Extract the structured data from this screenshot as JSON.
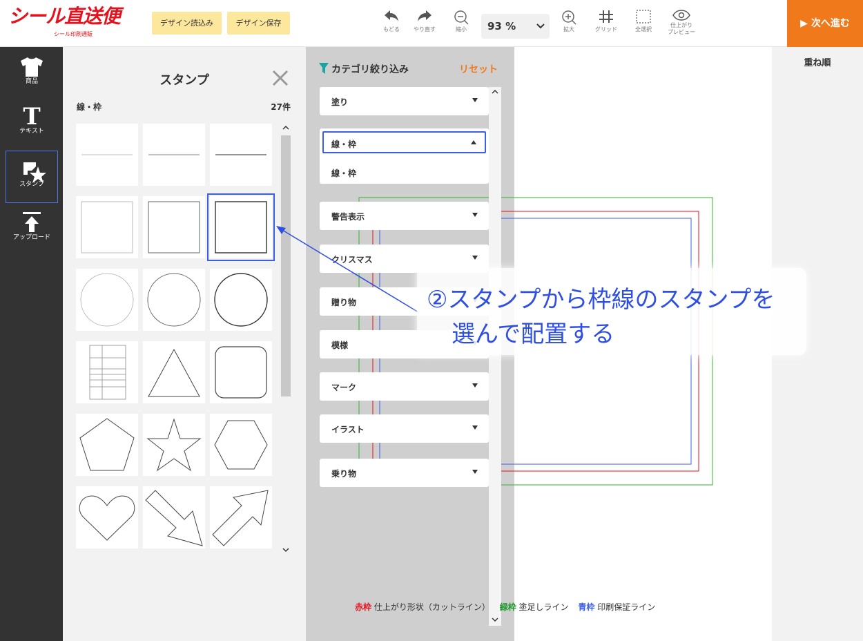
{
  "header": {
    "logo_main": "シール直送便",
    "logo_sub": "シール印刷通販",
    "buttons": {
      "load": "デザイン読込み",
      "save": "デザイン保存"
    },
    "tools": {
      "undo": "もどる",
      "redo": "やり直す",
      "zoom_out": "縮小",
      "zoom_in": "拡大",
      "grid": "グリッド",
      "select_all": "全選択",
      "preview_line1": "仕上がり",
      "preview_line2": "プレビュー"
    },
    "zoom_value": "93 %",
    "next_button": "▶ 次へ進む"
  },
  "sidebar": {
    "items": [
      {
        "label": "商品",
        "icon": "tshirt-icon"
      },
      {
        "label": "テキスト",
        "icon": "text-t-icon"
      },
      {
        "label": "スタンプ",
        "icon": "stamp-icon"
      },
      {
        "label": "アップロード",
        "icon": "upload-icon"
      }
    ]
  },
  "stamp_panel": {
    "title": "スタンプ",
    "category": "線・枠",
    "count": "27件",
    "items": [
      "thin-line",
      "medium-line",
      "thick-line",
      "thin-square",
      "medium-square",
      "thick-square",
      "thin-circle",
      "medium-circle",
      "thick-circle",
      "table-grid",
      "triangle",
      "rounded-square",
      "pentagon",
      "star",
      "hexagon",
      "heart",
      "arrow-down-right",
      "arrow-up-right"
    ],
    "selected_index": 5
  },
  "filter_panel": {
    "title": "カテゴリ絞り込み",
    "reset": "リセット",
    "categories": [
      {
        "label": "塗り"
      },
      {
        "label": "線・枠",
        "open": true,
        "option": "線・枠"
      },
      {
        "label": "警告表示"
      },
      {
        "label": "クリスマス"
      },
      {
        "label": "贈り物"
      },
      {
        "label": "模様"
      },
      {
        "label": "マーク"
      },
      {
        "label": "イラスト"
      },
      {
        "label": "乗り物"
      }
    ]
  },
  "canvas": {
    "legend": {
      "red_label": "赤枠",
      "red_desc": "仕上がり形状（カットライン）",
      "green_label": "緑枠",
      "green_desc": "塗足しライン",
      "blue_label": "青枠",
      "blue_desc": "印刷保証ライン"
    },
    "colors": {
      "red": "#e5121d",
      "green": "#2db52d",
      "blue": "#3b5ee8"
    }
  },
  "right_panel": {
    "title": "重ね順"
  },
  "annotation": {
    "line1": "②スタンプから枠線のスタンプを",
    "line2": "選んで配置する"
  }
}
